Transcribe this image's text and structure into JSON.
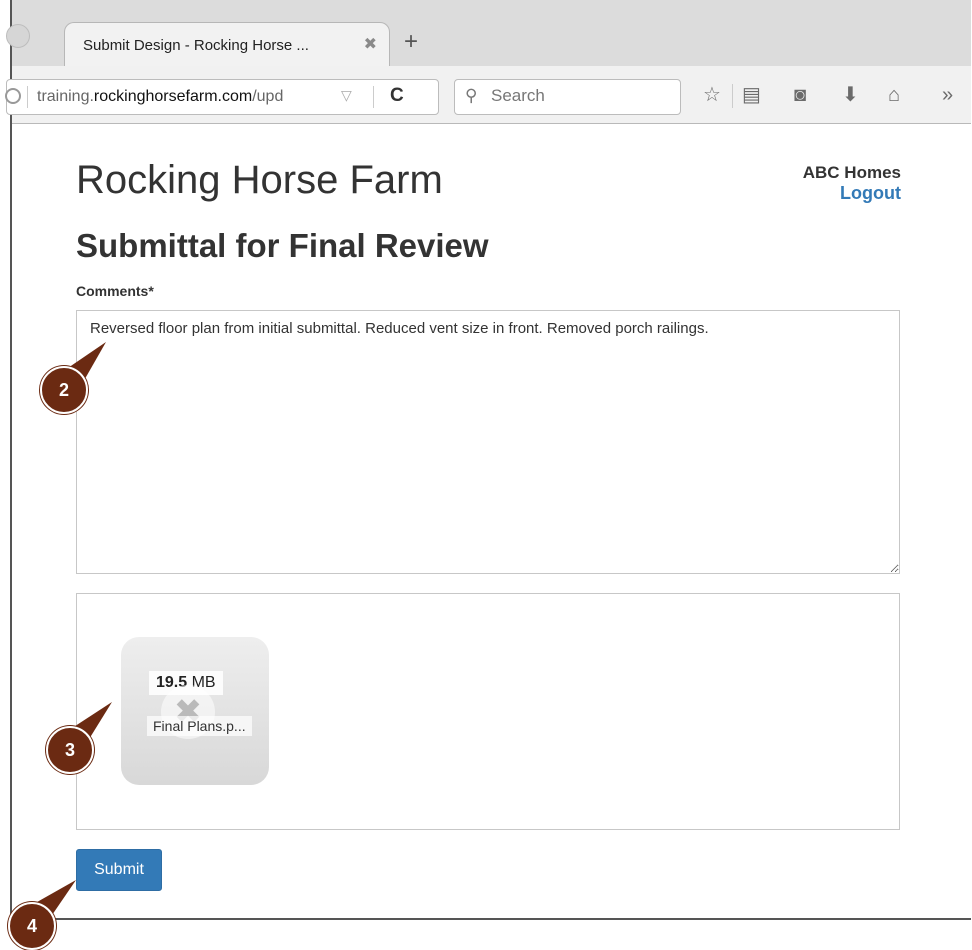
{
  "browser": {
    "tab_title": "Submit Design - Rocking Horse ...",
    "tab_close": "✖",
    "new_tab": "+",
    "url_prefix": "training.",
    "url_domain": "rockinghorsefarm.com",
    "url_path": "/upd",
    "reload": "C",
    "search_placeholder": "Search"
  },
  "header": {
    "site_title": "Rocking Horse Farm",
    "account_name": "ABC Homes",
    "logout_label": "Logout"
  },
  "main": {
    "page_title": "Submittal for Final Review",
    "comments_label": "Comments*",
    "comments_value": "Reversed floor plan from initial submittal. Reduced vent size in front. Removed porch railings.",
    "file": {
      "size_number": "19.5",
      "size_unit": "MB",
      "name": "Final Plans.p..."
    },
    "submit_label": "Submit"
  },
  "callouts": [
    "2",
    "3",
    "4"
  ],
  "colors": {
    "link": "#337ab7",
    "primary_button": "#337ab7",
    "callout": "#6b2a12"
  }
}
